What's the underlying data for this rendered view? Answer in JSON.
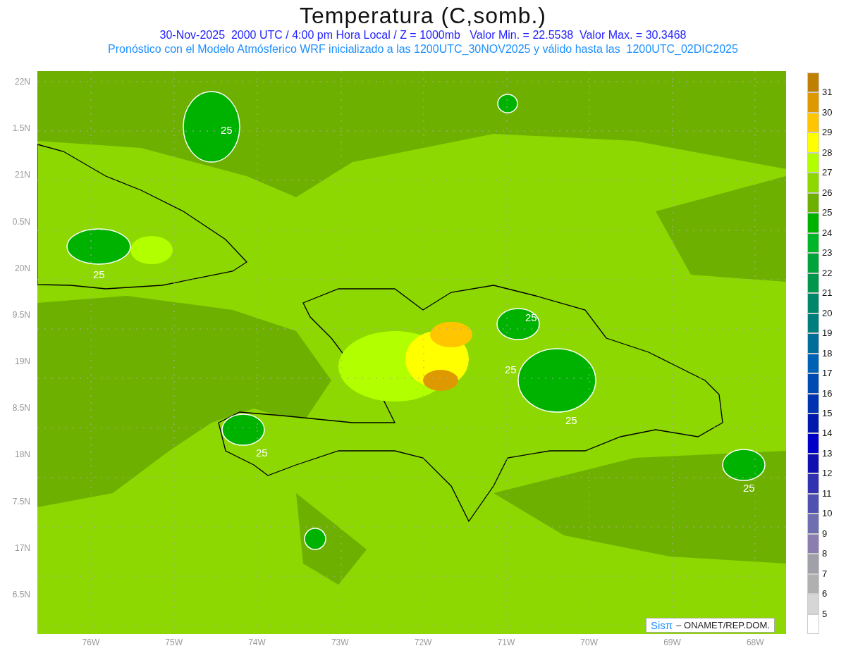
{
  "title": "Temperatura (C,somb.)",
  "subtitle": "30-Nov-2025  2000 UTC / 4:00 pm Hora Local / Z = 1000mb   Valor Min. = 22.5538  Valor Max. = 30.3468",
  "description": "Pronóstico con el Modelo Atmósferico WRF inicializado a las 1200UTC_30NOV2025 y válido hasta las  1200UTC_02DIC2025",
  "y_ticks": [
    "22N",
    "1.5N",
    "21N",
    "0.5N",
    "20N",
    "9.5N",
    "19N",
    "8.5N",
    "18N",
    "7.5N",
    "17N",
    "6.5N"
  ],
  "x_ticks": [
    "76W",
    "75W",
    "74W",
    "73W",
    "72W",
    "71W",
    "70W",
    "69W",
    "68W"
  ],
  "contour_labels": [
    "25",
    "25",
    "25",
    "25",
    "25",
    "25",
    "25"
  ],
  "credit": {
    "logo": "Sisπ",
    "text": "– ONAMET/REP.DOM."
  },
  "legend": [
    {
      "color": "#bf7f00",
      "label": "31"
    },
    {
      "color": "#df9900",
      "label": "30"
    },
    {
      "color": "#ffc600",
      "label": "29"
    },
    {
      "color": "#ffff00",
      "label": "28"
    },
    {
      "color": "#b2ff00",
      "label": "27"
    },
    {
      "color": "#8cd800",
      "label": "26"
    },
    {
      "color": "#6db000",
      "label": "25"
    },
    {
      "color": "#00b200",
      "label": "24"
    },
    {
      "color": "#00b628",
      "label": "23"
    },
    {
      "color": "#00a33a",
      "label": "22"
    },
    {
      "color": "#00964c",
      "label": "21"
    },
    {
      "color": "#00876a",
      "label": "20"
    },
    {
      "color": "#007d7d",
      "label": "19"
    },
    {
      "color": "#006e99",
      "label": "18"
    },
    {
      "color": "#0062b4",
      "label": "17"
    },
    {
      "color": "#004ab4",
      "label": "16"
    },
    {
      "color": "#0033b0",
      "label": "15"
    },
    {
      "color": "#0019ad",
      "label": "14"
    },
    {
      "color": "#0000c8",
      "label": "13"
    },
    {
      "color": "#1010b0",
      "label": "12"
    },
    {
      "color": "#3232b0",
      "label": "11"
    },
    {
      "color": "#5050b0",
      "label": "10"
    },
    {
      "color": "#6e6eb0",
      "label": "9"
    },
    {
      "color": "#8c7db0",
      "label": "8"
    },
    {
      "color": "#a0a0a8",
      "label": "7"
    },
    {
      "color": "#b0b0b0",
      "label": "6"
    },
    {
      "color": "#d6d6d6",
      "label": "5"
    },
    {
      "color": "#ffffff"
    }
  ]
}
